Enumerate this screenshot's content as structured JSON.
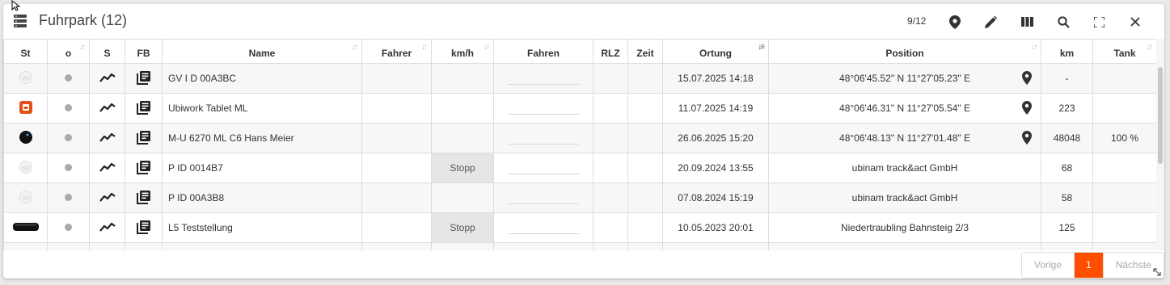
{
  "window": {
    "title": "Fuhrpark (12)",
    "pagination_count": "9/12"
  },
  "header_buttons": [
    {
      "icon": "map-pin-icon"
    },
    {
      "icon": "pencil-icon"
    },
    {
      "icon": "columns-icon"
    },
    {
      "icon": "search-icon"
    },
    {
      "icon": "fullscreen-icon"
    },
    {
      "icon": "close-icon"
    }
  ],
  "columns": [
    "St",
    "o",
    "S",
    "FB",
    "Name",
    "Fahrer",
    "km/h",
    "Fahren",
    "RLZ",
    "Zeit",
    "Ortung",
    "Position",
    "km",
    "Tank"
  ],
  "rows": [
    {
      "device": "white-round",
      "name": "GV I D 00A3BC",
      "fahrer": "",
      "kmh": "",
      "rlz": "",
      "zeit": "",
      "ortung": "15.07.2025 14:18",
      "position": "48°06'45.52\" N 11°27'05.23\" E",
      "has_pin": true,
      "km": "-",
      "tank": ""
    },
    {
      "device": "orange-tablet",
      "name": "Ubiwork Tablet ML",
      "fahrer": "",
      "kmh": "",
      "rlz": "",
      "zeit": "",
      "ortung": "11.07.2025 14:19",
      "position": "48°06'46.31\" N 11°27'05.54\" E",
      "has_pin": true,
      "km": "223",
      "tank": ""
    },
    {
      "device": "black-round",
      "name": "M-U 6270 ML C6 Hans Meier",
      "fahrer": "",
      "kmh": "",
      "rlz": "",
      "zeit": "",
      "ortung": "26.06.2025 15:20",
      "position": "48°06'48.13\" N 11°27'01.48\" E",
      "has_pin": true,
      "km": "48048",
      "tank": "100 %"
    },
    {
      "device": "white-round",
      "name": "P ID 0014B7",
      "fahrer": "",
      "kmh": "Stopp",
      "rlz": "",
      "zeit": "",
      "ortung": "20.09.2024 13:55",
      "position": "ubinam track&act GmbH",
      "has_pin": false,
      "km": "68",
      "tank": ""
    },
    {
      "device": "white-round",
      "name": "P ID 00A3B8",
      "fahrer": "",
      "kmh": "",
      "rlz": "",
      "zeit": "",
      "ortung": "07.08.2024 15:19",
      "position": "ubinam track&act GmbH",
      "has_pin": false,
      "km": "58",
      "tank": ""
    },
    {
      "device": "black-box",
      "name": "L5 Teststellung",
      "fahrer": "",
      "kmh": "Stopp",
      "rlz": "",
      "zeit": "",
      "ortung": "10.05.2023 20:01",
      "position": "Niedertraubling Bahnsteig 2/3",
      "has_pin": false,
      "km": "125",
      "tank": ""
    },
    {
      "device": "",
      "name": "",
      "fahrer": "",
      "kmh": "",
      "rlz": "",
      "zeit": "",
      "ortung": "",
      "position": "",
      "has_pin": false,
      "km": "",
      "tank": ""
    }
  ],
  "pager": {
    "prev": "Vorige",
    "current": "1",
    "next": "Nächste"
  },
  "colors": {
    "accent": "#ff4e00",
    "stopp_bg": "#e6e6e6"
  }
}
